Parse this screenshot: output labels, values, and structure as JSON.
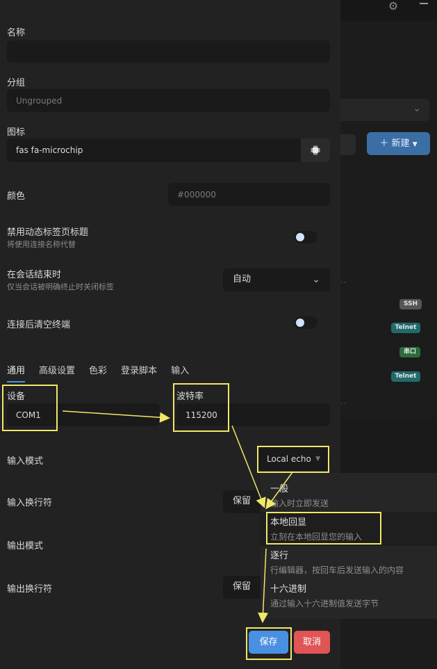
{
  "form": {
    "name_label": "名称",
    "name_value": "",
    "group_label": "分组",
    "group_placeholder": "Ungrouped",
    "icon_label": "图标",
    "icon_value": "fas fa-microchip",
    "color_label": "颜色",
    "color_placeholder": "#000000",
    "disable_dynamic_title_label": "禁用动态标签页标题",
    "disable_dynamic_title_hint": "将使用连接名称代替",
    "on_session_end_label": "在会话结束时",
    "on_session_end_hint": "仅当会话被明确终止时关闭标签",
    "on_session_end_value": "自动",
    "clear_terminal_label": "连接后清空终端"
  },
  "tabs": [
    "通用",
    "高级设置",
    "色彩",
    "登录脚本",
    "输入"
  ],
  "serial": {
    "device_label": "设备",
    "device_value": "COM1",
    "baud_label": "波特率",
    "baud_value": "115200",
    "input_mode_label": "输入模式",
    "input_mode_value": "Local echo",
    "input_newline_label": "输入换行符",
    "input_newline_value": "保留",
    "output_mode_label": "输出模式",
    "output_newline_label": "输出换行符",
    "output_newline_value": "保留"
  },
  "input_mode_options": [
    {
      "title": "一般",
      "desc": "输入时立即发送"
    },
    {
      "title": "本地回显",
      "desc": "立刻在本地回显您的输入"
    },
    {
      "title": "逐行",
      "desc": "行编辑器，按回车后发送输入的内容"
    },
    {
      "title": "十六进制",
      "desc": "通过输入十六进制值发送字节"
    }
  ],
  "buttons": {
    "save": "保存",
    "cancel": "取消"
  },
  "background": {
    "new_button": "新建",
    "badges": [
      "SSH",
      "Telnet",
      "串口",
      "Telnet"
    ]
  },
  "colors": {
    "accent": "#4a90e2",
    "save": "#4a90e2",
    "cancel": "#e05555",
    "highlight": "#f0e86a",
    "badge_ssh": "#555555",
    "badge_telnet": "#1f6b6b",
    "badge_serial": "#2e6b3c"
  }
}
